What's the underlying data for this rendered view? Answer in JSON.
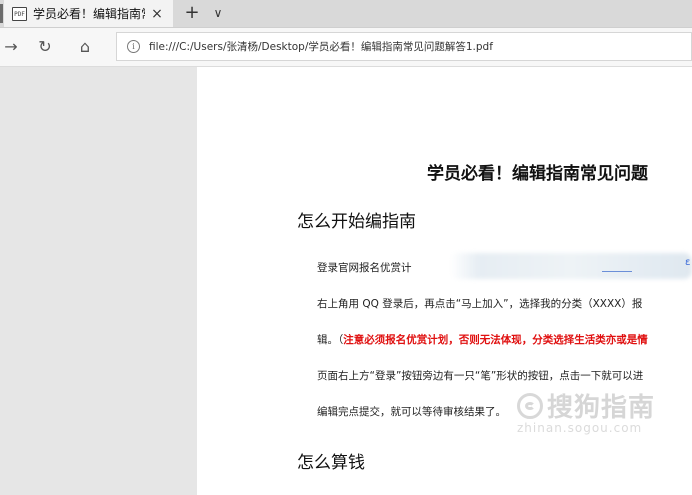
{
  "tab": {
    "icon": "pdf-icon",
    "title": "学员必看！编辑指南常见",
    "close_glyph": "×"
  },
  "tabstrip": {
    "new_tab_glyph": "+",
    "menu_glyph": "∨"
  },
  "nav": {
    "forward_glyph": "→",
    "refresh_glyph": "↻",
    "home_glyph": "⌂"
  },
  "address": {
    "info_glyph": "i",
    "url": "file:///C:/Users/张清杨/Desktop/学员必看！编辑指南常见问题解答1.pdf"
  },
  "document": {
    "title": "学员必看！编辑指南常见问题",
    "sections": [
      {
        "heading": "怎么开始编指南"
      },
      {
        "heading": "怎么算钱"
      }
    ],
    "paragraphs": [
      "登录官网报名优赏计",
      "右上角用 QQ 登录后，再点击“马上加入”，选择我的分类（XXXX）报",
      "辑。（",
      "页面右上方“登录”按钮旁边有一只“笔”形状的按钮，点击一下就可以进",
      "编辑完点提交，就可以等待审核结果了。"
    ],
    "red_notice": "注意必须报名优赏计划，否则无法体现，分类选择生活类亦或是情",
    "link_fragment": "ε"
  },
  "watermark": {
    "text": "搜狗指南",
    "url": "zhinan.sogou.com"
  }
}
